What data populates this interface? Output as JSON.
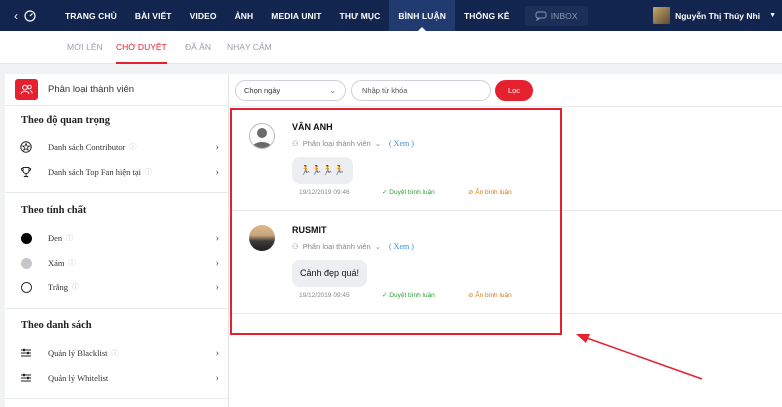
{
  "topbar": {
    "nav": [
      "TRANG CHỦ",
      "BÀI VIẾT",
      "VIDEO",
      "ẢNH",
      "MEDIA UNIT",
      "THƯ MỤC",
      "BÌNH LUẬN",
      "THỐNG KÊ"
    ],
    "active_index": 6,
    "inbox": "INBOX",
    "user_name": "Nguyễn Thị Thúy Nhi"
  },
  "subtabs": [
    "MỚI LÊN",
    "CHỜ DUYỆT",
    "ĐÃ ẨN",
    "NHẠY CẢM"
  ],
  "sidebar": {
    "header": "Phân loại thành viên",
    "sections": [
      {
        "title": "Theo độ quan trọng",
        "items": [
          "Danh sách Contributor",
          "Danh sách Top Fan hiện tại"
        ]
      },
      {
        "title": "Theo tính chất",
        "items": [
          "Đen",
          "Xám",
          "Trắng"
        ]
      },
      {
        "title": "Theo danh sách",
        "items": [
          "Quản lý Blacklist",
          "Quản lý Whitelist"
        ]
      }
    ]
  },
  "filter": {
    "date_select": "Chọn ngày",
    "keyword_placeholder": "Nhập từ khóa",
    "filter_button": "Lọc"
  },
  "comments": [
    {
      "name": "VÂN ANH",
      "classify": "Phân loại thành viên",
      "view": "( Xem )",
      "text": "🏃🏃🏃🏃",
      "time": "19/12/2019 09:46",
      "approve": "Duyệt bình luận",
      "hide": "Ẩn bình luận"
    },
    {
      "name": "RUSMIT",
      "classify": "Phân loại thành viên",
      "view": "( Xem )",
      "text": "Cảnh đẹp quá!",
      "time": "19/12/2019 09:45",
      "approve": "Duyệt bình luận",
      "hide": "Ẩn bình luận"
    }
  ],
  "colors": {
    "nav_bg": "#12254e",
    "accent": "#e5202f",
    "approve": "#2e9e3a",
    "hide": "#d17c12"
  }
}
